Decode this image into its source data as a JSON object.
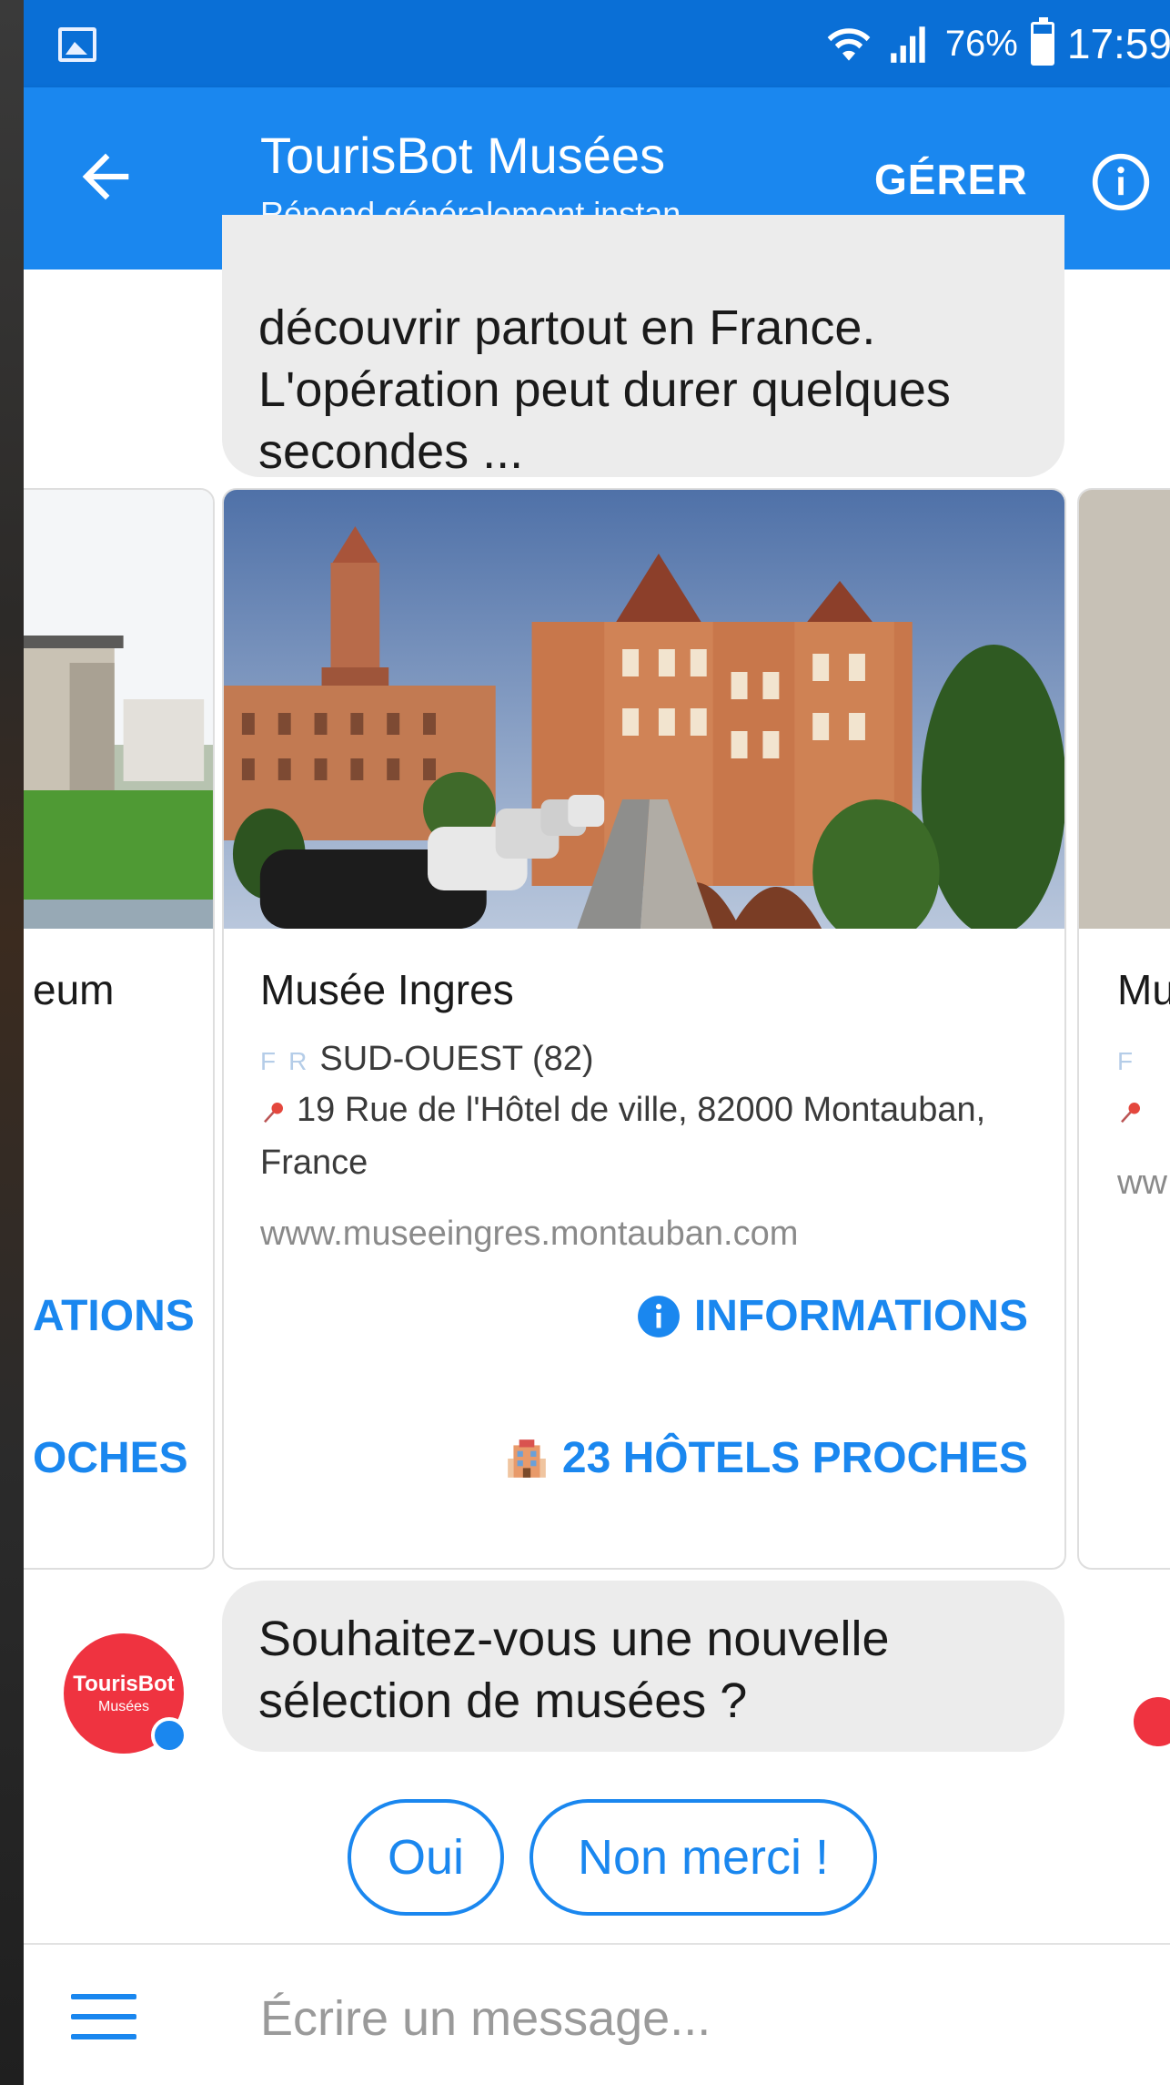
{
  "status_bar": {
    "battery": "76%",
    "time": "17:59"
  },
  "header": {
    "title": "TourisBot Musées",
    "subtitle": "Répond généralement instan...",
    "manage_label": "GÉRER"
  },
  "messages": {
    "top_text": "découvrir partout en France. L'opération peut durer quelques secondes ...",
    "bottom_text": "Souhaitez-vous une nouvelle sélection de musées ?"
  },
  "cards": {
    "left": {
      "title_fragment": "eum",
      "action_info_fragment": "ATIONS",
      "action_hotels_fragment": "OCHES"
    },
    "main": {
      "title": "Musée Ingres",
      "region": "SUD-OUEST (82)",
      "address": "19 Rue de l'Hôtel de ville, 82000 Montauban, France",
      "website": "www.museeingres.montauban.com",
      "action_info": "INFORMATIONS",
      "action_hotels": "23 HÔTELS PROCHES",
      "flag_f": "F",
      "flag_r": "R"
    },
    "right": {
      "title_fragment": "Mu",
      "website_fragment": "ww",
      "flag_f": "F"
    }
  },
  "avatar": {
    "name": "TourisBot",
    "sub": "Musées"
  },
  "quick_replies": [
    {
      "label": "Oui"
    },
    {
      "label": "Non merci !"
    }
  ],
  "composer": {
    "placeholder": "Écrire un message..."
  },
  "colors": {
    "messenger_blue": "#1a87ef",
    "status_blue": "#0a6fd6",
    "bubble_gray": "#ececec",
    "avatar_red": "#ef3340"
  }
}
